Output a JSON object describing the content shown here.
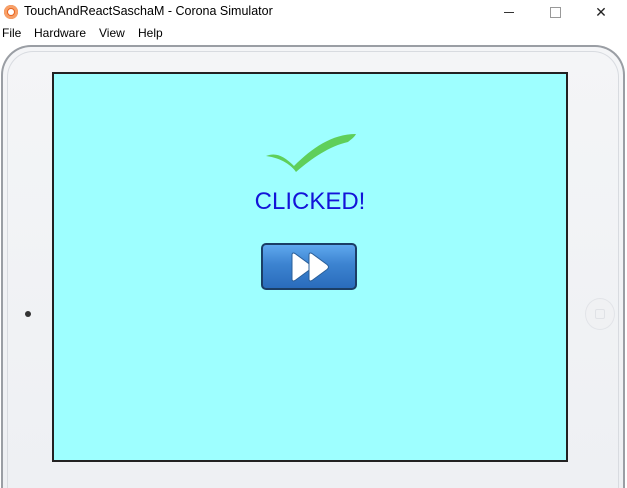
{
  "window": {
    "title": "TouchAndReactSaschaM - Corona Simulator",
    "controls": {
      "minimize": "minimize-icon",
      "maximize": "maximize-icon",
      "close": "✕"
    }
  },
  "menu": [
    "File",
    "Hardware",
    "View",
    "Help"
  ],
  "simulator": {
    "device": "tablet",
    "screen": {
      "background": "#9effff",
      "status_text": "CLICKED!",
      "status_color": "#1414d8",
      "checkmark_color": "#5fcf5a",
      "next_button_icon": "fast-forward-icon"
    }
  }
}
